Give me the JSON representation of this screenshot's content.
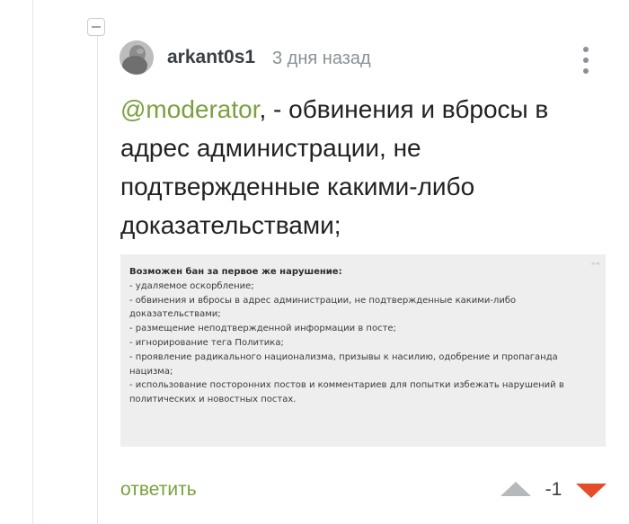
{
  "comment": {
    "username": "arkant0s1",
    "timestamp": "3 дня назад",
    "mention": "@moderator",
    "text_after_mention": ", - обвинения и вбросы в адрес администрации, не подтвержденные какими-либо доказательствами;",
    "avatar_icon": "avatar-photo",
    "more_icon": "vertical-dots-icon"
  },
  "quote": {
    "title": "Возможен бан за первое же нарушение:",
    "lines": [
      "- удаляемое оскорбление;",
      "- обвинения и вбросы в адрес администрации, не подтвержденные какими-либо доказательствами;",
      "- размещение неподтвержденной информации в посте;",
      "- игнорирование тега Политика;",
      "- проявление радикального национализма, призывы к насилию, одобрение и пропаганда нацизма;",
      "- использование посторонних постов и комментариев для попытки избежать нарушений в политических и новостных постах."
    ],
    "quote_mark": "““"
  },
  "actions": {
    "reply_label": "ответить",
    "rating": "-1",
    "upvote_icon": "triangle-up-icon",
    "downvote_icon": "triangle-down-icon"
  },
  "colors": {
    "accent_green": "#7aa13e",
    "downvote_red": "#e54d28",
    "upvote_gray": "#b6b9bc",
    "quote_bg": "#eeeeee"
  }
}
